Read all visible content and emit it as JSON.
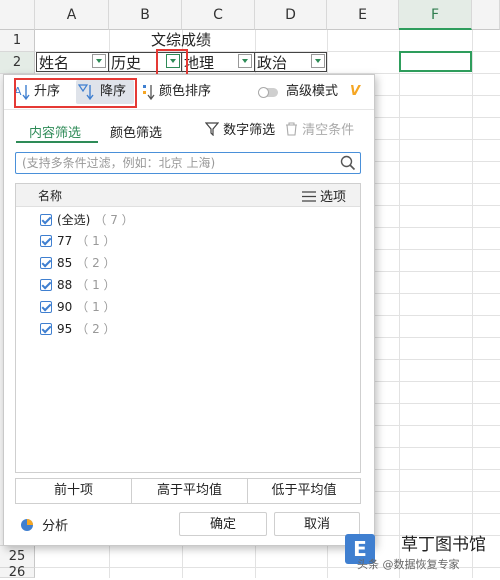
{
  "sheet": {
    "columns": [
      "A",
      "B",
      "C",
      "D",
      "E",
      "F"
    ],
    "rows": [
      "1",
      "2",
      "25",
      "26"
    ],
    "title": "文综成绩",
    "headers": [
      "姓名",
      "历史",
      "地理",
      "政治"
    ]
  },
  "filter": {
    "sort_asc": "升序",
    "sort_desc": "降序",
    "color_sort": "颜色排序",
    "advanced_mode": "高级模式",
    "tab_content": "内容筛选",
    "tab_color": "颜色筛选",
    "number_filter": "数字筛选",
    "clear_conditions": "清空条件",
    "search_placeholder": "(支持多条件过滤，例如：北京 上海)",
    "list_header": "名称",
    "options": "选项",
    "items": [
      {
        "label": "(全选)",
        "count": "（ 7 ）"
      },
      {
        "label": "77",
        "count": "（ 1 ）"
      },
      {
        "label": "85",
        "count": "（ 2 ）"
      },
      {
        "label": "88",
        "count": "（ 1 ）"
      },
      {
        "label": "90",
        "count": "（ 1 ）"
      },
      {
        "label": "95",
        "count": "（ 2 ）"
      }
    ],
    "top10": "前十项",
    "above_avg": "高于平均值",
    "below_avg": "低于平均值",
    "analysis": "分析",
    "ok": "确定",
    "cancel": "取消"
  },
  "watermark": {
    "brand": "草丁图书馆",
    "sub": "头条 @数据恢复专家"
  },
  "colors": {
    "accent_green": "#2e8b57",
    "highlight_red": "#e53935",
    "search_blue": "#4a90d9"
  }
}
